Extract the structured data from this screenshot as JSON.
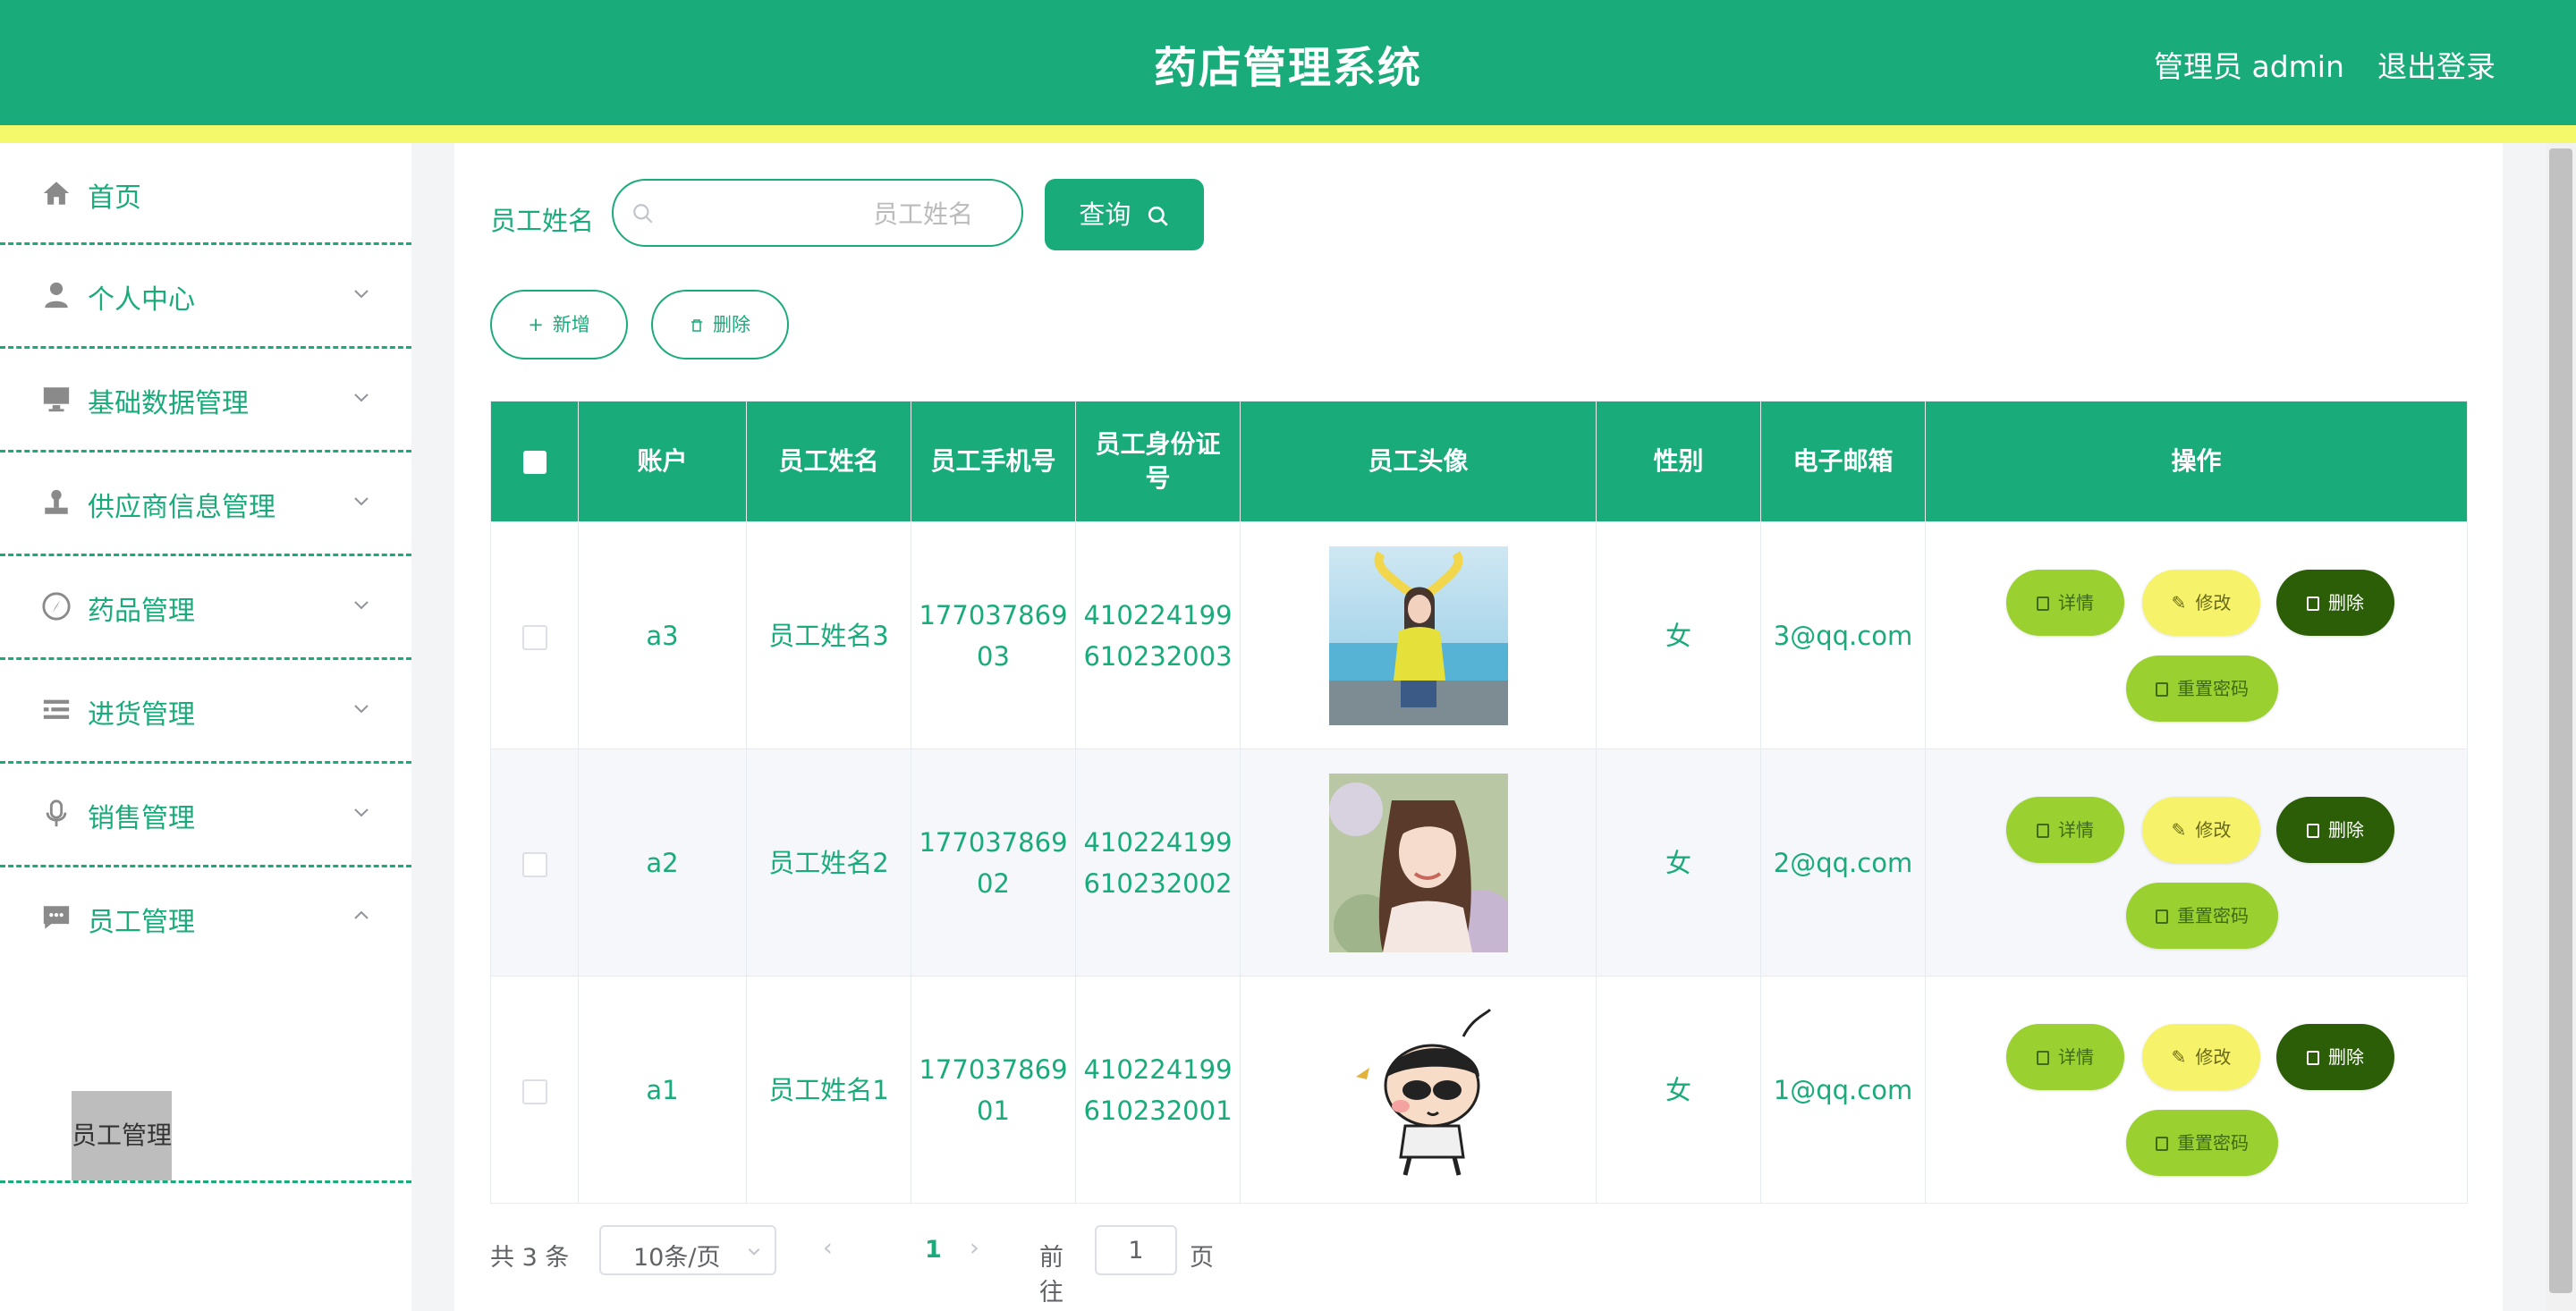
{
  "header": {
    "title": "药店管理系统",
    "user": "管理员 admin",
    "logout": "退出登录"
  },
  "sidebar": {
    "items": [
      {
        "label": "首页",
        "icon": "home-icon"
      },
      {
        "label": "个人中心",
        "icon": "user-icon"
      },
      {
        "label": "基础数据管理",
        "icon": "monitor-icon"
      },
      {
        "label": "供应商信息管理",
        "icon": "person-stamp-icon"
      },
      {
        "label": "药品管理",
        "icon": "compass-icon"
      },
      {
        "label": "进货管理",
        "icon": "list-icon"
      },
      {
        "label": "销售管理",
        "icon": "microphone-icon"
      },
      {
        "label": "员工管理",
        "icon": "chat-icon"
      }
    ],
    "active_sub": "员工管理"
  },
  "search": {
    "label": "员工姓名",
    "placeholder": "员工姓名",
    "button": "查询"
  },
  "actions": {
    "add": "新增",
    "delete": "删除"
  },
  "table": {
    "headers": [
      "账户",
      "员工姓名",
      "员工手机号",
      "员工身份证号",
      "员工头像",
      "性别",
      "电子邮箱",
      "操作"
    ],
    "rows": [
      {
        "account": "a3",
        "name": "员工姓名3",
        "phone": "17703786903",
        "id_card": "410224199610232003",
        "gender": "女",
        "email": "3@qq.com",
        "avatar": "avatar-girl-yellow-sweater"
      },
      {
        "account": "a2",
        "name": "员工姓名2",
        "phone": "17703786902",
        "id_card": "410224199610232002",
        "gender": "女",
        "email": "2@qq.com",
        "avatar": "avatar-girl-flowers"
      },
      {
        "account": "a1",
        "name": "员工姓名1",
        "phone": "17703786901",
        "id_card": "410224199610232001",
        "gender": "女",
        "email": "1@qq.com",
        "avatar": "avatar-cartoon-boy"
      }
    ],
    "row_buttons": {
      "detail": "详情",
      "edit": "修改",
      "delete": "删除",
      "reset": "重置密码"
    }
  },
  "pagination": {
    "total": "共 3 条",
    "page_size": "10条/页",
    "current_page": "1",
    "goto_label": "前往",
    "goto_value": "1",
    "page_unit": "页"
  },
  "colors": {
    "primary": "#1aab7a",
    "accent_yellow": "#f4f96b",
    "lime": "#9ad02f",
    "dark_green": "#2c5e08"
  }
}
